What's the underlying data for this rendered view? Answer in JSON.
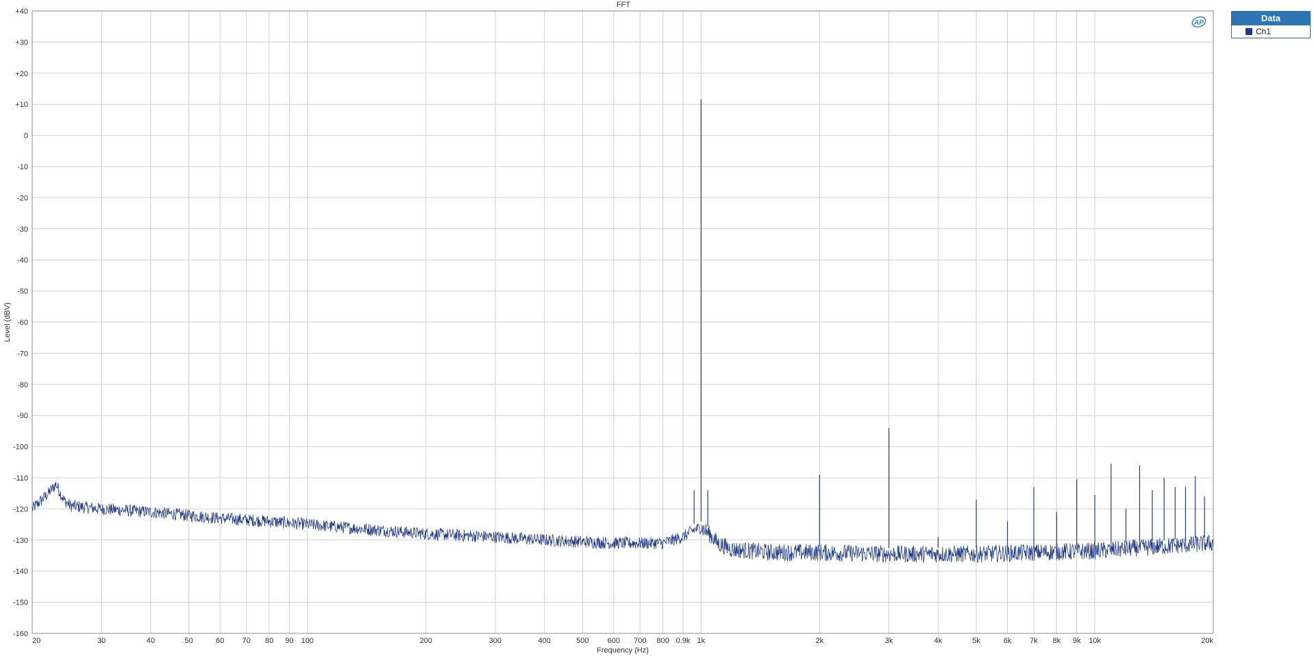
{
  "chart_data": {
    "type": "line",
    "title": "FFT",
    "xlabel": "Frequency (Hz)",
    "ylabel": "Level (dBV)",
    "x_scale": "log",
    "xlim": [
      20,
      20000
    ],
    "ylim": [
      -160,
      40
    ],
    "grid": true,
    "legend_placement": "right",
    "x_ticks": [
      {
        "value": 20,
        "label": "20"
      },
      {
        "value": 30,
        "label": "30"
      },
      {
        "value": 40,
        "label": "40"
      },
      {
        "value": 50,
        "label": "50"
      },
      {
        "value": 60,
        "label": "60"
      },
      {
        "value": 70,
        "label": "70"
      },
      {
        "value": 80,
        "label": "80"
      },
      {
        "value": 90,
        "label": "90"
      },
      {
        "value": 100,
        "label": "100"
      },
      {
        "value": 200,
        "label": "200"
      },
      {
        "value": 300,
        "label": "300"
      },
      {
        "value": 400,
        "label": "400"
      },
      {
        "value": 500,
        "label": "500"
      },
      {
        "value": 600,
        "label": "600"
      },
      {
        "value": 700,
        "label": "700"
      },
      {
        "value": 800,
        "label": "800"
      },
      {
        "value": 900,
        "label": "0.9k"
      },
      {
        "value": 1000,
        "label": "1k"
      },
      {
        "value": 2000,
        "label": "2k"
      },
      {
        "value": 3000,
        "label": "3k"
      },
      {
        "value": 4000,
        "label": "4k"
      },
      {
        "value": 5000,
        "label": "5k"
      },
      {
        "value": 6000,
        "label": "6k"
      },
      {
        "value": 7000,
        "label": "7k"
      },
      {
        "value": 8000,
        "label": "8k"
      },
      {
        "value": 9000,
        "label": "9k"
      },
      {
        "value": 10000,
        "label": "10k"
      },
      {
        "value": 20000,
        "label": "20k"
      }
    ],
    "y_ticks": [
      {
        "value": 40,
        "label": "+40"
      },
      {
        "value": 30,
        "label": "+30"
      },
      {
        "value": 20,
        "label": "+20"
      },
      {
        "value": 10,
        "label": "+10"
      },
      {
        "value": 0,
        "label": "0"
      },
      {
        "value": -10,
        "label": "-10"
      },
      {
        "value": -20,
        "label": "-20"
      },
      {
        "value": -30,
        "label": "-30"
      },
      {
        "value": -40,
        "label": "-40"
      },
      {
        "value": -50,
        "label": "-50"
      },
      {
        "value": -60,
        "label": "-60"
      },
      {
        "value": -70,
        "label": "-70"
      },
      {
        "value": -80,
        "label": "-80"
      },
      {
        "value": -90,
        "label": "-90"
      },
      {
        "value": -100,
        "label": "-100"
      },
      {
        "value": -110,
        "label": "-110"
      },
      {
        "value": -120,
        "label": "-120"
      },
      {
        "value": -130,
        "label": "-130"
      },
      {
        "value": -140,
        "label": "-140"
      },
      {
        "value": -150,
        "label": "-150"
      },
      {
        "value": -160,
        "label": "-160"
      }
    ],
    "series": [
      {
        "name": "Ch1",
        "color": "#1f3a8a",
        "noise_floor": [
          [
            20,
            -120
          ],
          [
            22,
            -115
          ],
          [
            23,
            -112
          ],
          [
            24,
            -117
          ],
          [
            25,
            -119
          ],
          [
            30,
            -120
          ],
          [
            40,
            -121
          ],
          [
            60,
            -123
          ],
          [
            80,
            -124
          ],
          [
            100,
            -125
          ],
          [
            200,
            -128
          ],
          [
            300,
            -129
          ],
          [
            400,
            -130
          ],
          [
            600,
            -131
          ],
          [
            800,
            -131
          ],
          [
            900,
            -129
          ],
          [
            950,
            -127
          ],
          [
            1000,
            -126
          ],
          [
            1050,
            -128
          ],
          [
            1100,
            -131
          ],
          [
            1200,
            -133
          ],
          [
            1500,
            -134
          ],
          [
            2000,
            -134
          ],
          [
            3000,
            -134.5
          ],
          [
            5000,
            -134.5
          ],
          [
            7000,
            -134
          ],
          [
            10000,
            -133.5
          ],
          [
            15000,
            -132
          ],
          [
            20000,
            -131
          ]
        ],
        "peaks": [
          [
            960,
            -114
          ],
          [
            1000,
            11.5
          ],
          [
            1040,
            -114
          ],
          [
            2000,
            -109
          ],
          [
            3000,
            -94
          ],
          [
            4000,
            -129
          ],
          [
            5000,
            -117
          ],
          [
            6000,
            -124
          ],
          [
            7000,
            -113
          ],
          [
            8000,
            -121
          ],
          [
            9000,
            -110.5
          ],
          [
            10000,
            -115.5
          ],
          [
            11000,
            -105.5
          ],
          [
            12000,
            -120
          ],
          [
            13000,
            -106
          ],
          [
            14000,
            -114
          ],
          [
            15000,
            -110
          ],
          [
            16000,
            -113
          ],
          [
            17000,
            -113
          ],
          [
            18000,
            -109.5
          ],
          [
            19000,
            -116
          ]
        ]
      }
    ]
  },
  "legend": {
    "header": "Data",
    "items": [
      {
        "label": "Ch1",
        "color": "#1f3a8a"
      }
    ]
  },
  "logo": {
    "text": "AP",
    "color": "#2e86c1"
  }
}
